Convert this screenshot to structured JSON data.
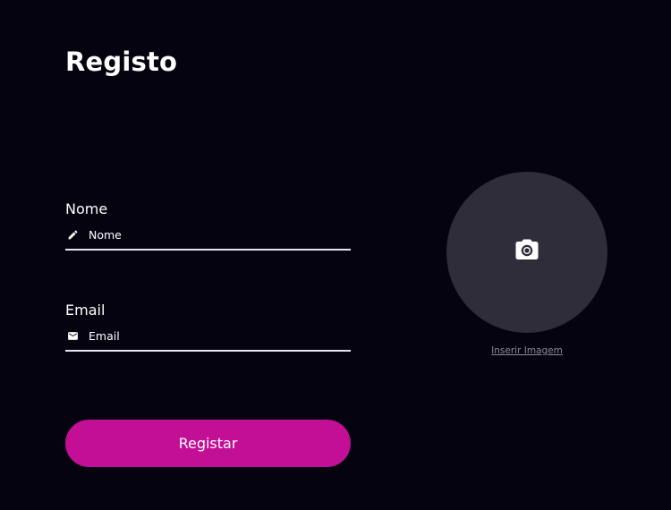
{
  "page": {
    "title": "Registo"
  },
  "form": {
    "name_field": {
      "label": "Nome",
      "placeholder": "Nome",
      "value": "",
      "icon": "pencil-icon"
    },
    "email_field": {
      "label": "Email",
      "placeholder": "Email",
      "value": "",
      "icon": "mail-icon"
    },
    "submit_label": "Registar"
  },
  "avatar": {
    "icon": "camera-icon",
    "upload_label": "Inserir Imagem"
  },
  "colors": {
    "background": "#05030f",
    "accent": "#c20f96",
    "avatar_background": "#2e2d39",
    "input_underline": "#e7e5ee",
    "muted_text": "#8b8a96"
  }
}
